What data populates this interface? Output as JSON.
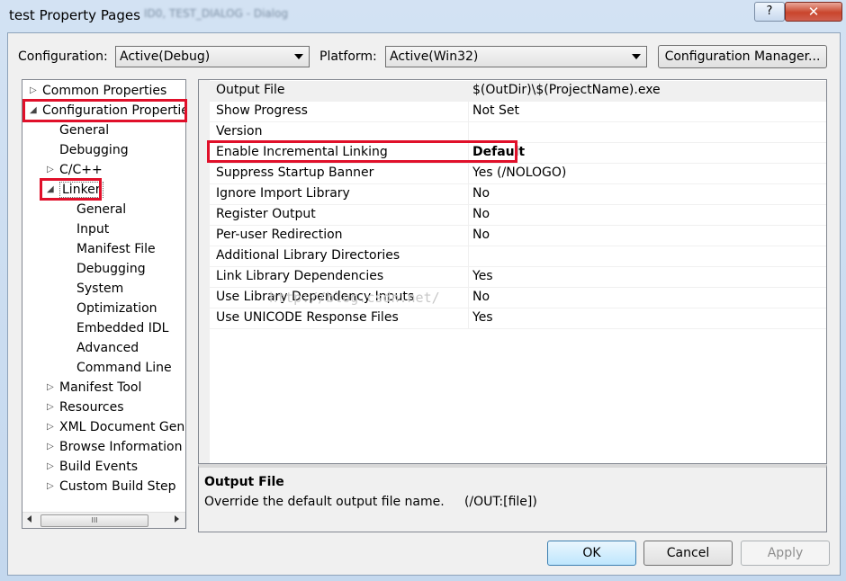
{
  "window": {
    "title": "test Property Pages",
    "background_title": "ID0, TEST_DIALOG - Dialog",
    "help_label": "?",
    "close_label": "✕"
  },
  "toolbar": {
    "configuration_label": "Configuration:",
    "configuration_value": "Active(Debug)",
    "platform_label": "Platform:",
    "platform_value": "Active(Win32)",
    "config_manager_label": "Configuration Manager..."
  },
  "tree": {
    "common_properties": "Common Properties",
    "configuration_properties": "Configuration Propertie",
    "general": "General",
    "debugging": "Debugging",
    "cpp": "C/C++",
    "linker": "Linker",
    "linker_children": [
      "General",
      "Input",
      "Manifest File",
      "Debugging",
      "System",
      "Optimization",
      "Embedded IDL",
      "Advanced",
      "Command Line"
    ],
    "manifest_tool": "Manifest Tool",
    "resources": "Resources",
    "xml_document": "XML Document Gene",
    "browse_information": "Browse Information",
    "build_events": "Build Events",
    "custom_build_step": "Custom Build Step",
    "scroll_grip": "III"
  },
  "properties": [
    {
      "name": "Output File",
      "value": "$(OutDir)\\$(ProjectName).exe"
    },
    {
      "name": "Show Progress",
      "value": "Not Set"
    },
    {
      "name": "Version",
      "value": ""
    },
    {
      "name": "Enable Incremental Linking",
      "value": "Default"
    },
    {
      "name": "Suppress Startup Banner",
      "value": "Yes (/NOLOGO)"
    },
    {
      "name": "Ignore Import Library",
      "value": "No"
    },
    {
      "name": "Register Output",
      "value": "No"
    },
    {
      "name": "Per-user Redirection",
      "value": "No"
    },
    {
      "name": "Additional Library Directories",
      "value": ""
    },
    {
      "name": "Link Library Dependencies",
      "value": "Yes"
    },
    {
      "name": "Use Library Dependency Inputs",
      "value": "No"
    },
    {
      "name": "Use UNICODE Response Files",
      "value": "Yes"
    }
  ],
  "watermark": "http://blog.csdn.net/",
  "description": {
    "title": "Output File",
    "text": "Override the default output file name.     (/OUT:[file])"
  },
  "buttons": {
    "ok": "OK",
    "cancel": "Cancel",
    "apply": "Apply"
  },
  "colors": {
    "highlight_box": "#e0102a",
    "close_button": "#c9452c"
  }
}
